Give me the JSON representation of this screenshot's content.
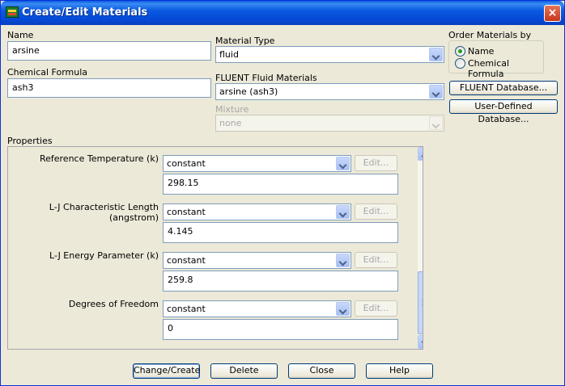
{
  "window": {
    "title": "Create/Edit Materials",
    "close_symbol": "×"
  },
  "name": {
    "label": "Name",
    "value": "arsine"
  },
  "chemical_formula": {
    "label": "Chemical Formula",
    "value": "ash3"
  },
  "material_type": {
    "label": "Material Type",
    "value": "fluid"
  },
  "fluent_fluid_materials": {
    "label": "FLUENT Fluid Materials",
    "value": "arsine (ash3)"
  },
  "mixture": {
    "label": "Mixture",
    "value": "none"
  },
  "order_by": {
    "label": "Order Materials by",
    "options": [
      {
        "label": "Name",
        "checked": true
      },
      {
        "label": "Chemical Formula",
        "checked": false
      }
    ]
  },
  "side_buttons": {
    "fluent_db": "FLUENT Database...",
    "user_db": "User-Defined Database..."
  },
  "properties": {
    "label": "Properties",
    "items": [
      {
        "label": "Reference Temperature (k)",
        "method": "constant",
        "edit": "Edit...",
        "value": "298.15"
      },
      {
        "label": "L-J Characteristic Length (angstrom)",
        "method": "constant",
        "edit": "Edit...",
        "value": "4.145"
      },
      {
        "label": "L-J Energy Parameter (k)",
        "method": "constant",
        "edit": "Edit...",
        "value": "259.8"
      },
      {
        "label": "Degrees of Freedom",
        "method": "constant",
        "edit": "Edit...",
        "value": "0"
      }
    ]
  },
  "footer": {
    "change_create": "Change/Create",
    "delete": "Delete",
    "close": "Close",
    "help": "Help"
  }
}
